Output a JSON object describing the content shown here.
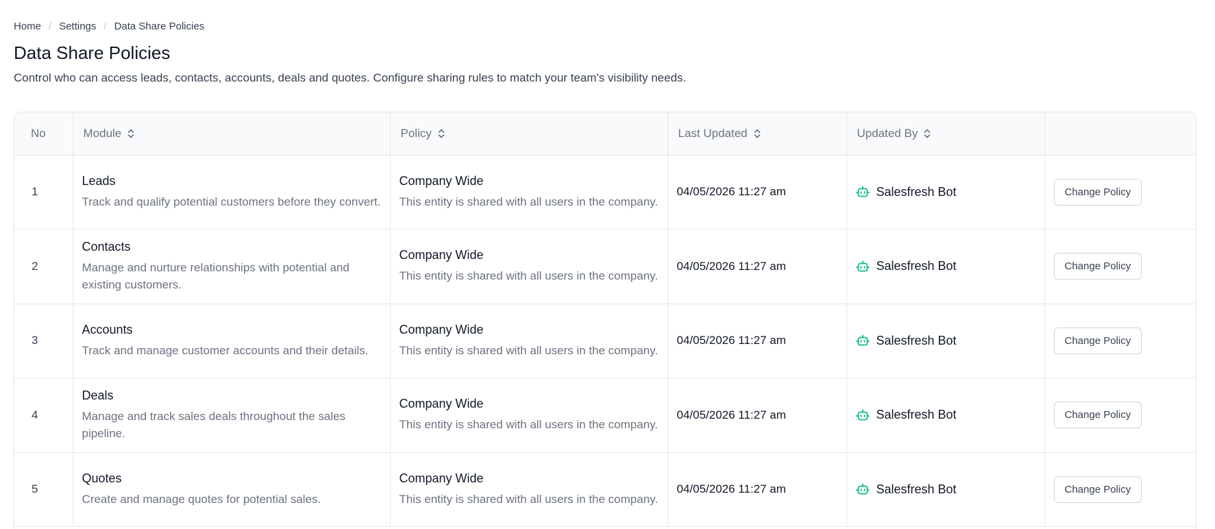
{
  "breadcrumb": [
    "Home",
    "Settings",
    "Data Share Policies"
  ],
  "page": {
    "title": "Data Share Policies",
    "description": "Control who can access leads, contacts, accounts, deals and quotes. Configure sharing rules to match your team's visibility needs."
  },
  "table": {
    "headers": [
      "No",
      "Module",
      "Policy",
      "Last Updated",
      "Updated By",
      ""
    ],
    "rows": [
      {
        "no": "1",
        "module": "Leads",
        "module_desc": "Track and qualify potential customers before they convert.",
        "policy": "Company Wide",
        "policy_desc": "This entity is shared with all users in the company.",
        "updated": "04/05/2026 11:27 am",
        "updated_by": "Salesfresh Bot",
        "action": "Change Policy"
      },
      {
        "no": "2",
        "module": "Contacts",
        "module_desc": "Manage and nurture relationships with potential and existing customers.",
        "policy": "Company Wide",
        "policy_desc": "This entity is shared with all users in the company.",
        "updated": "04/05/2026 11:27 am",
        "updated_by": "Salesfresh Bot",
        "action": "Change Policy"
      },
      {
        "no": "3",
        "module": "Accounts",
        "module_desc": "Track and manage customer accounts and their details.",
        "policy": "Company Wide",
        "policy_desc": "This entity is shared with all users in the company.",
        "updated": "04/05/2026 11:27 am",
        "updated_by": "Salesfresh Bot",
        "action": "Change Policy"
      },
      {
        "no": "4",
        "module": "Deals",
        "module_desc": "Manage and track sales deals throughout the sales pipeline.",
        "policy": "Company Wide",
        "policy_desc": "This entity is shared with all users in the company.",
        "updated": "04/05/2026 11:27 am",
        "updated_by": "Salesfresh Bot",
        "action": "Change Policy"
      },
      {
        "no": "5",
        "module": "Quotes",
        "module_desc": "Create and manage quotes for potential sales.",
        "policy": "Company Wide",
        "policy_desc": "This entity is shared with all users in the company.",
        "updated": "04/05/2026 11:27 am",
        "updated_by": "Salesfresh Bot",
        "action": "Change Policy"
      }
    ]
  },
  "icons": {
    "sort": "sort-icon",
    "bot": "bot-icon"
  },
  "colors": {
    "bot_icon": "#10b981",
    "border": "#e5e7eb",
    "muted_text": "#6b7280"
  }
}
